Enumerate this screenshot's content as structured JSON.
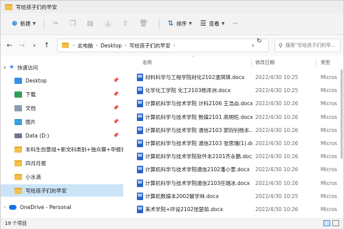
{
  "window": {
    "title": "写给孩子们的早安"
  },
  "toolbar": {
    "new_label": "新建",
    "sort_label": "排序",
    "view_label": "查看",
    "more_label": "···"
  },
  "address": {
    "crumbs": [
      "此电脑",
      "Desktop",
      "写给孩子们的早安"
    ]
  },
  "search": {
    "placeholder": "搜索\"写给孩子们的早..."
  },
  "sidebar": {
    "quick_access": "快速访问",
    "items": [
      {
        "label": "Desktop",
        "icon": "desktop-icon",
        "pinned": true
      },
      {
        "label": "下载",
        "icon": "download-icon",
        "pinned": true
      },
      {
        "label": "文档",
        "icon": "documents-icon",
        "pinned": true
      },
      {
        "label": "图片",
        "icon": "pictures-icon",
        "pinned": true
      },
      {
        "label": "Data (D:)",
        "icon": "drive-icon",
        "pinned": true
      },
      {
        "label": "本科生创意组+新文科类别+独众赛+申报表计",
        "icon": "folder-icon",
        "pinned": false
      },
      {
        "label": "四月月报",
        "icon": "folder-icon",
        "pinned": false
      },
      {
        "label": "小水滴",
        "icon": "folder-icon",
        "pinned": false
      },
      {
        "label": "写给孩子们的早安",
        "icon": "folder-icon",
        "pinned": false,
        "selected": true
      }
    ],
    "onedrive": "OneDrive - Personal"
  },
  "columns": {
    "name": "名称",
    "date": "修改日期",
    "type": "类型"
  },
  "files": [
    {
      "name": "材料科学与工程学院材化2102温琪琪.docx",
      "date": "2022/4/30 10:25",
      "type": "Micros"
    },
    {
      "name": "化学化工学院 化工2103杨泽洲.docx",
      "date": "2022/4/30 10:25",
      "type": "Micros"
    },
    {
      "name": "计算机科学与技术学院 计科2106 王浩焱.docx",
      "date": "2022/4/30 10:26",
      "type": "Micros"
    },
    {
      "name": "计算机科学与技术学院 数媒2101 高明旺.docx",
      "date": "2022/4/30 10:26",
      "type": "Micros"
    },
    {
      "name": "计算机科学与技术学院 通信2103 郭钧钊杨本...",
      "date": "2022/4/30 10:26",
      "type": "Micros"
    },
    {
      "name": "计算机科学与技术学院 通信2103 张思瑞(1).do...",
      "date": "2022/4/30 10:26",
      "type": "Micros"
    },
    {
      "name": "计算机科学与技术学院软件本2101齐永鹏.docx",
      "date": "2022/4/30 10:26",
      "type": "Micros"
    },
    {
      "name": "计算机科学与技术学院通信2102潘小萱.docx",
      "date": "2022/4/30 10:26",
      "type": "Micros"
    },
    {
      "name": "计算机科学与技术学院通信2103任瑞冰.docx",
      "date": "2022/4/30 10:26",
      "type": "Micros"
    },
    {
      "name": "计算机数媒本2002解学林.docx",
      "date": "2022/4/30 10:25",
      "type": "Micros"
    },
    {
      "name": "美术学院+环设2102张楚茹.docx",
      "date": "2022/4/30 10:26",
      "type": "Micros"
    }
  ],
  "status": {
    "count_text": "19 个项目"
  }
}
